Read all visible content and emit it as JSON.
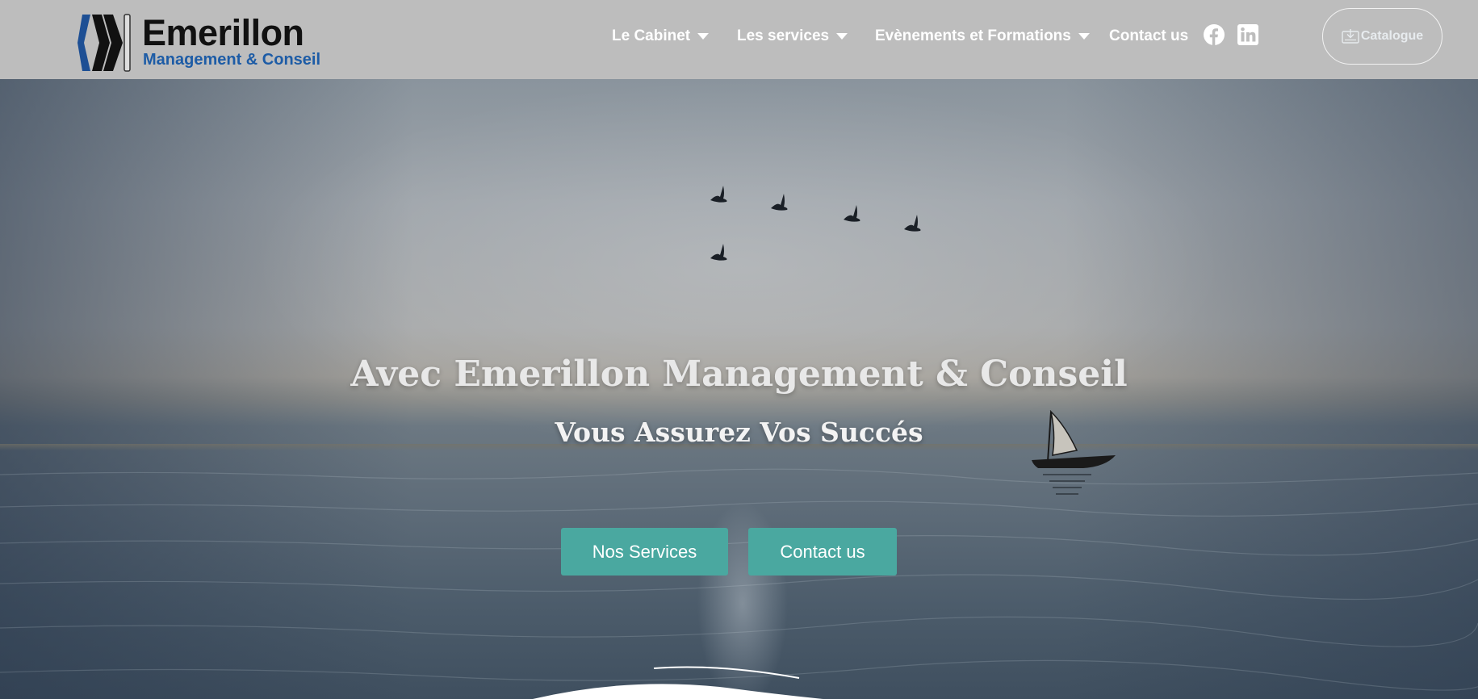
{
  "brand": {
    "name": "Emerillon",
    "tagline": "Management & Conseil",
    "title_color": "#111111",
    "tagline_color": "#1d5ca6"
  },
  "nav": {
    "items": [
      {
        "label": "Le Cabinet",
        "has_dropdown": true
      },
      {
        "label": "Les services",
        "has_dropdown": true
      },
      {
        "label": "Evènements et Formations",
        "has_dropdown": true
      },
      {
        "label": "Contact us",
        "has_dropdown": false
      }
    ],
    "social": [
      {
        "icon": "facebook-icon"
      },
      {
        "icon": "linkedin-icon"
      }
    ],
    "catalogue": {
      "label": "Catalogue",
      "icon": "download-icon"
    }
  },
  "hero": {
    "title": "Avec Emerillon Management & Conseil",
    "subtitle": "Vous Assurez Vos Succés",
    "buttons": {
      "services": "Nos Services",
      "contact": "Contact us"
    },
    "button_color": "#4aa8a0"
  }
}
